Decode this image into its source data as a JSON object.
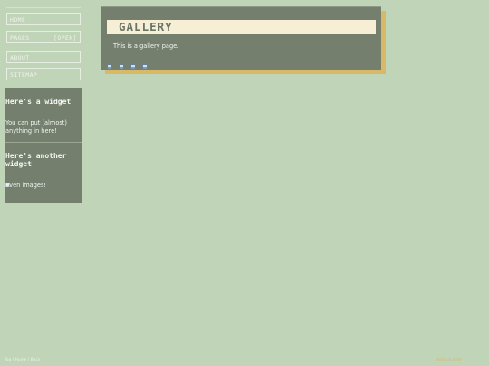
{
  "nav": {
    "items": [
      {
        "label": "HOME",
        "extra": ""
      },
      {
        "label": "PAGES",
        "extra": "[OPEN]"
      },
      {
        "label": "ABOUT",
        "extra": ""
      },
      {
        "label": "SITEMAP",
        "extra": ""
      }
    ]
  },
  "widgets": [
    {
      "title": "Here's a widget",
      "text": "You can put (almost) anything in here!"
    },
    {
      "title": "Here's another widget",
      "text": "Even images!"
    }
  ],
  "page": {
    "title": "GALLERY",
    "text": "This is a gallery page."
  },
  "footer": {
    "left": "Top | Home | Back",
    "right": "design & code"
  },
  "colors": {
    "background": "#c0d4b8",
    "panel": "#747f6e",
    "accent": "#d8b968",
    "title_bar": "#f6efd6"
  }
}
